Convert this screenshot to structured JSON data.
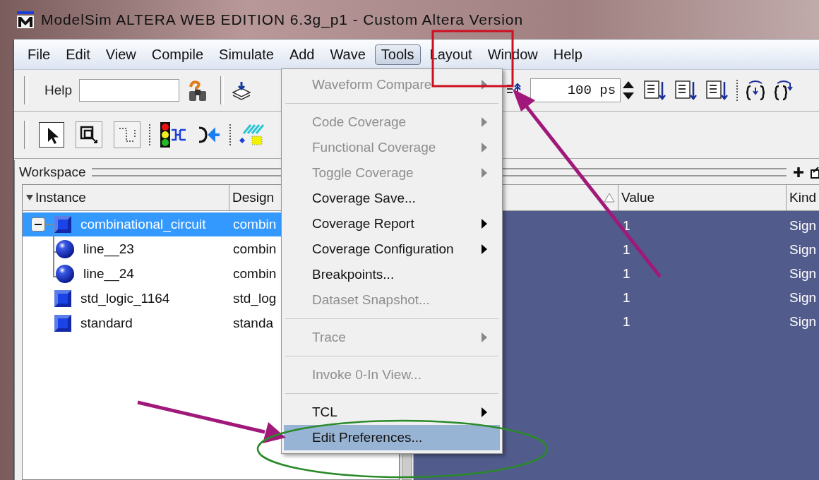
{
  "window": {
    "title": "ModelSim ALTERA WEB EDITION 6.3g_p1 - Custom Altera Version"
  },
  "menubar": [
    {
      "label": "File",
      "selected": false
    },
    {
      "label": "Edit",
      "selected": false
    },
    {
      "label": "View",
      "selected": false
    },
    {
      "label": "Compile",
      "selected": false
    },
    {
      "label": "Simulate",
      "selected": false
    },
    {
      "label": "Add",
      "selected": false
    },
    {
      "label": "Wave",
      "selected": false
    },
    {
      "label": "Tools",
      "selected": true
    },
    {
      "label": "Layout",
      "selected": false
    },
    {
      "label": "Window",
      "selected": false
    },
    {
      "label": "Help",
      "selected": false
    }
  ],
  "toolbar": {
    "help_label": "Help",
    "time_field": {
      "value": "100 ps"
    }
  },
  "workspace": {
    "title": "Workspace",
    "columns": [
      "Instance",
      "Design"
    ],
    "tree": [
      {
        "instance": "combinational_circuit",
        "design": "combin",
        "kind": "module",
        "selected": true,
        "expanded": true,
        "children": [
          {
            "instance": "line__23",
            "design": "combin",
            "kind": "process",
            "selected": false
          },
          {
            "instance": "line__24",
            "design": "combin",
            "kind": "process",
            "selected": false
          }
        ]
      },
      {
        "instance": "std_logic_1164",
        "design": "std_log",
        "kind": "module",
        "selected": false
      },
      {
        "instance": "standard",
        "design": "standa",
        "kind": "module",
        "selected": false
      }
    ]
  },
  "objects": {
    "columns": [
      "Value",
      "Kind"
    ],
    "rows": [
      {
        "value": "1",
        "signal_kind": "Sign",
        "selected": true
      },
      {
        "value": "1",
        "signal_kind": "Sign",
        "selected": true
      },
      {
        "value": "1",
        "signal_kind": "Sign",
        "selected": true
      },
      {
        "value": "1",
        "signal_kind": "Sign",
        "selected": true
      },
      {
        "value": "1",
        "signal_kind": "Sign",
        "selected": true
      }
    ]
  },
  "tools_menu": [
    {
      "kind": "item",
      "label": "Waveform Compare",
      "disabled": true,
      "submenu": true,
      "selected": false
    },
    {
      "kind": "separator"
    },
    {
      "kind": "item",
      "label": "Code Coverage",
      "disabled": true,
      "submenu": true,
      "selected": false
    },
    {
      "kind": "item",
      "label": "Functional Coverage",
      "disabled": true,
      "submenu": true,
      "selected": false
    },
    {
      "kind": "item",
      "label": "Toggle Coverage",
      "disabled": true,
      "submenu": true,
      "selected": false
    },
    {
      "kind": "item",
      "label": "Coverage Save...",
      "disabled": false,
      "submenu": false,
      "selected": false
    },
    {
      "kind": "item",
      "label": "Coverage Report",
      "disabled": false,
      "submenu": true,
      "selected": false
    },
    {
      "kind": "item",
      "label": "Coverage Configuration",
      "disabled": false,
      "submenu": true,
      "selected": false
    },
    {
      "kind": "item",
      "label": "Breakpoints...",
      "disabled": false,
      "submenu": false,
      "selected": false
    },
    {
      "kind": "item",
      "label": "Dataset Snapshot...",
      "disabled": true,
      "submenu": false,
      "selected": false
    },
    {
      "kind": "separator"
    },
    {
      "kind": "item",
      "label": "Trace",
      "disabled": true,
      "submenu": true,
      "selected": false
    },
    {
      "kind": "separator"
    },
    {
      "kind": "item",
      "label": "Invoke 0-In View...",
      "disabled": true,
      "submenu": false,
      "selected": false
    },
    {
      "kind": "separator"
    },
    {
      "kind": "item",
      "label": "TCL",
      "disabled": false,
      "submenu": true,
      "selected": false
    },
    {
      "kind": "item",
      "label": "Edit Preferences...",
      "disabled": false,
      "submenu": false,
      "selected": true
    }
  ]
}
